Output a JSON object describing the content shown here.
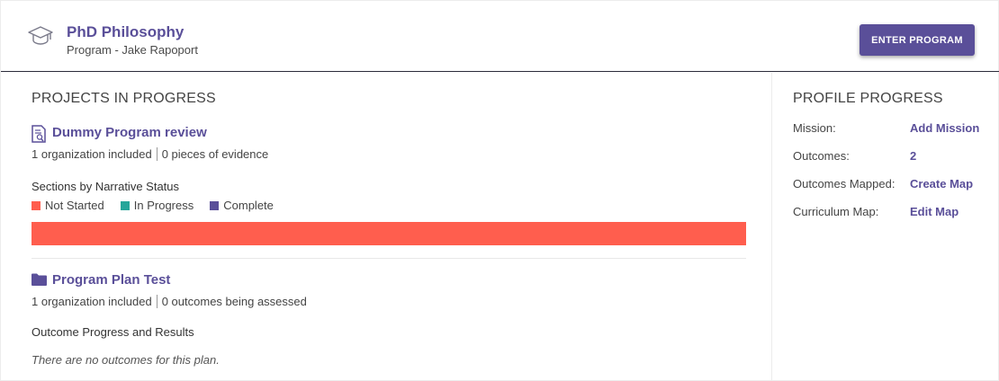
{
  "header": {
    "title": "PhD Philosophy",
    "subtitle": "Program - Jake Rapoport",
    "enter_button": "ENTER PROGRAM",
    "icon": "graduation-cap-icon"
  },
  "projects": {
    "heading": "PROJECTS IN PROGRESS",
    "items": [
      {
        "icon": "document-search-icon",
        "name": "Dummy Program review",
        "meta_left": "1 organization included",
        "meta_right": "0 pieces of evidence",
        "sub_heading": "Sections by Narrative Status",
        "legend": [
          {
            "label": "Not Started",
            "color": "#ff5e4e"
          },
          {
            "label": "In Progress",
            "color": "#26a69a"
          },
          {
            "label": "Complete",
            "color": "#5a4f99"
          }
        ],
        "status_fractions": {
          "not_started": 1.0,
          "in_progress": 0.0,
          "complete": 0.0
        }
      },
      {
        "icon": "folder-icon",
        "name": "Program Plan Test",
        "meta_left": "1 organization included",
        "meta_right": "0 outcomes being assessed",
        "sub_heading": "Outcome Progress and Results",
        "empty_note": "There are no outcomes for this plan."
      }
    ]
  },
  "profile": {
    "heading": "PROFILE PROGRESS",
    "rows": [
      {
        "label": "Mission:",
        "value": "Add Mission"
      },
      {
        "label": "Outcomes:",
        "value": "2"
      },
      {
        "label": "Outcomes Mapped:",
        "value": "Create Map"
      },
      {
        "label": "Curriculum Map:",
        "value": "Edit Map"
      }
    ]
  },
  "colors": {
    "accent": "#5a4f99",
    "not_started": "#ff5e4e",
    "in_progress": "#26a69a",
    "complete": "#5a4f99"
  }
}
